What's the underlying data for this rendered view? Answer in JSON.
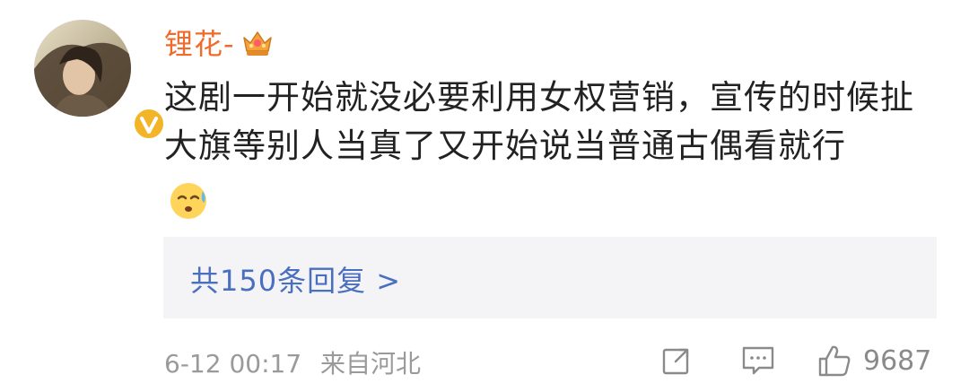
{
  "user": {
    "name": "锂花-",
    "avatar_icon": "avatar",
    "badge_icon": "verified-badge-icon",
    "vip_icon": "crown-icon"
  },
  "comment": {
    "text": "这剧一开始就没必要利用女权营销，宣传的时候扯大旗等别人当真了又开始说当普通古偶看就行",
    "emoji": "sweat-emoji"
  },
  "replies": {
    "label": "共150条回复 >"
  },
  "footer": {
    "date": "6-12 00:17",
    "source": "来自河北",
    "likes": "9687"
  },
  "colors": {
    "username": "#f06b2b",
    "link": "#4a6fbf",
    "text": "#222222",
    "meta": "#9a9a9a",
    "reply_bg": "#f4f4f6"
  }
}
